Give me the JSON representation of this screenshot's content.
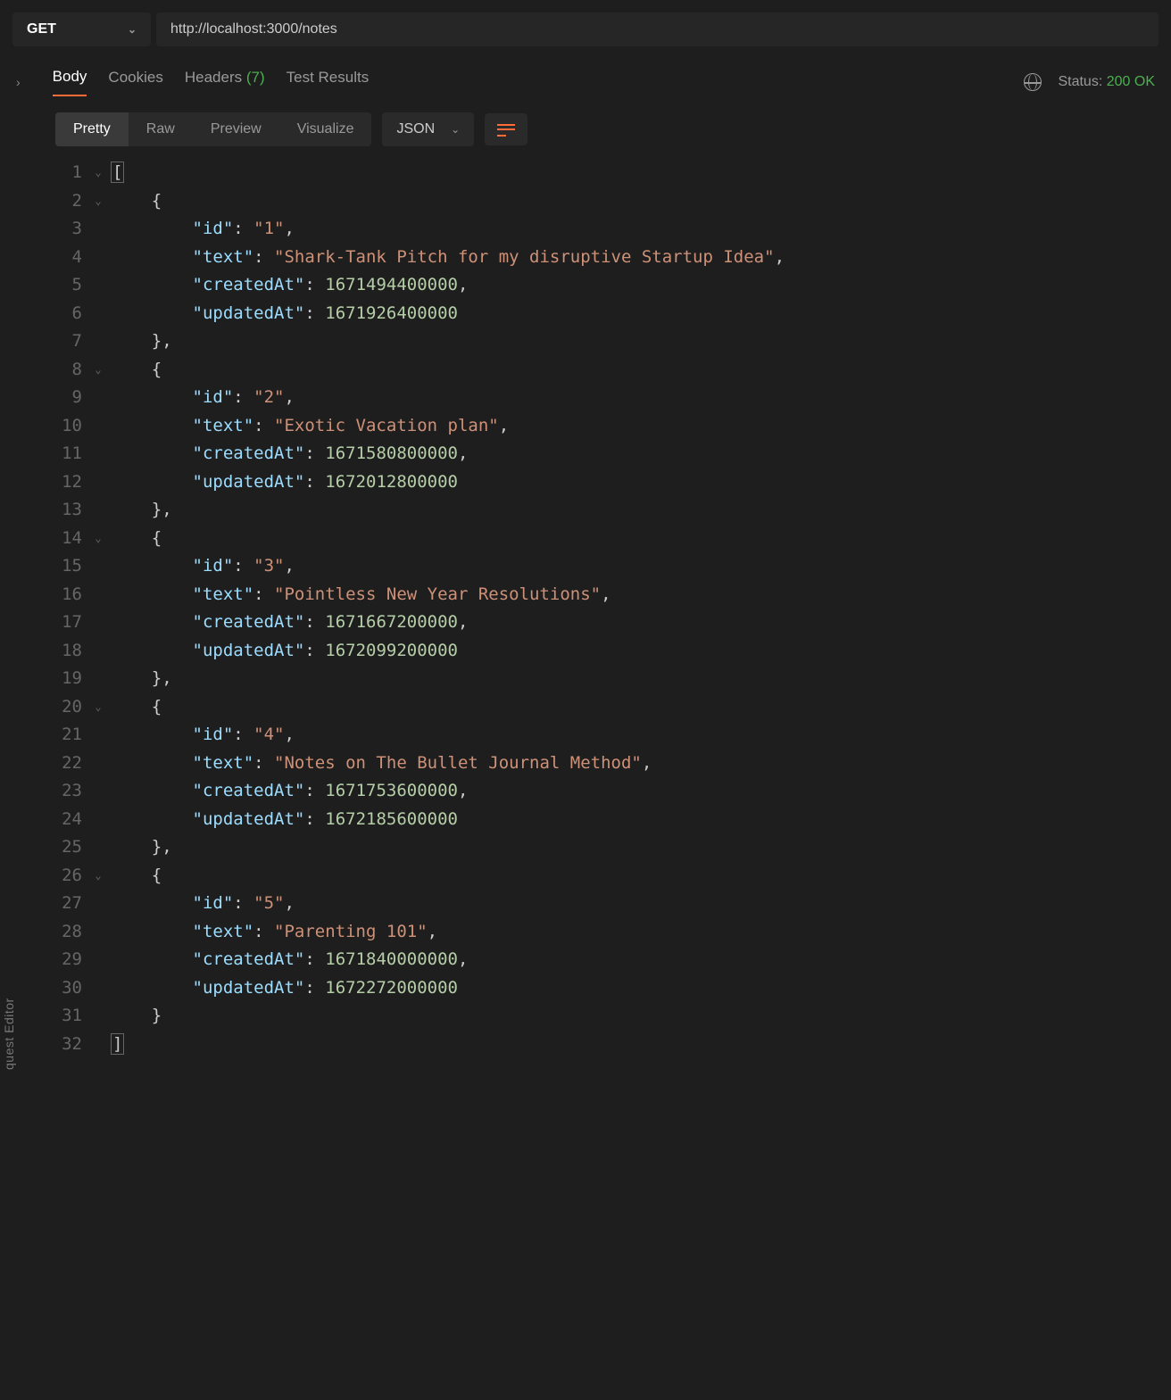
{
  "request": {
    "method": "GET",
    "url": "http://localhost:3000/notes"
  },
  "responseTabs": {
    "body": "Body",
    "cookies": "Cookies",
    "headers": "Headers",
    "headersCount": "(7)",
    "testResults": "Test Results"
  },
  "status": {
    "label": "Status:",
    "value": "200 OK"
  },
  "viewTabs": {
    "pretty": "Pretty",
    "raw": "Raw",
    "preview": "Preview",
    "visualize": "Visualize"
  },
  "format": "JSON",
  "sidebarLabel": "quest Editor",
  "responseBody": [
    {
      "id": "1",
      "text": "Shark-Tank Pitch for my disruptive Startup Idea",
      "createdAt": 1671494400000,
      "updatedAt": 1671926400000
    },
    {
      "id": "2",
      "text": "Exotic Vacation plan",
      "createdAt": 1671580800000,
      "updatedAt": 1672012800000
    },
    {
      "id": "3",
      "text": "Pointless New Year Resolutions",
      "createdAt": 1671667200000,
      "updatedAt": 1672099200000
    },
    {
      "id": "4",
      "text": "Notes on The Bullet Journal Method",
      "createdAt": 1671753600000,
      "updatedAt": 1672185600000
    },
    {
      "id": "5",
      "text": "Parenting 101",
      "createdAt": 1671840000000,
      "updatedAt": 1672272000000
    }
  ]
}
